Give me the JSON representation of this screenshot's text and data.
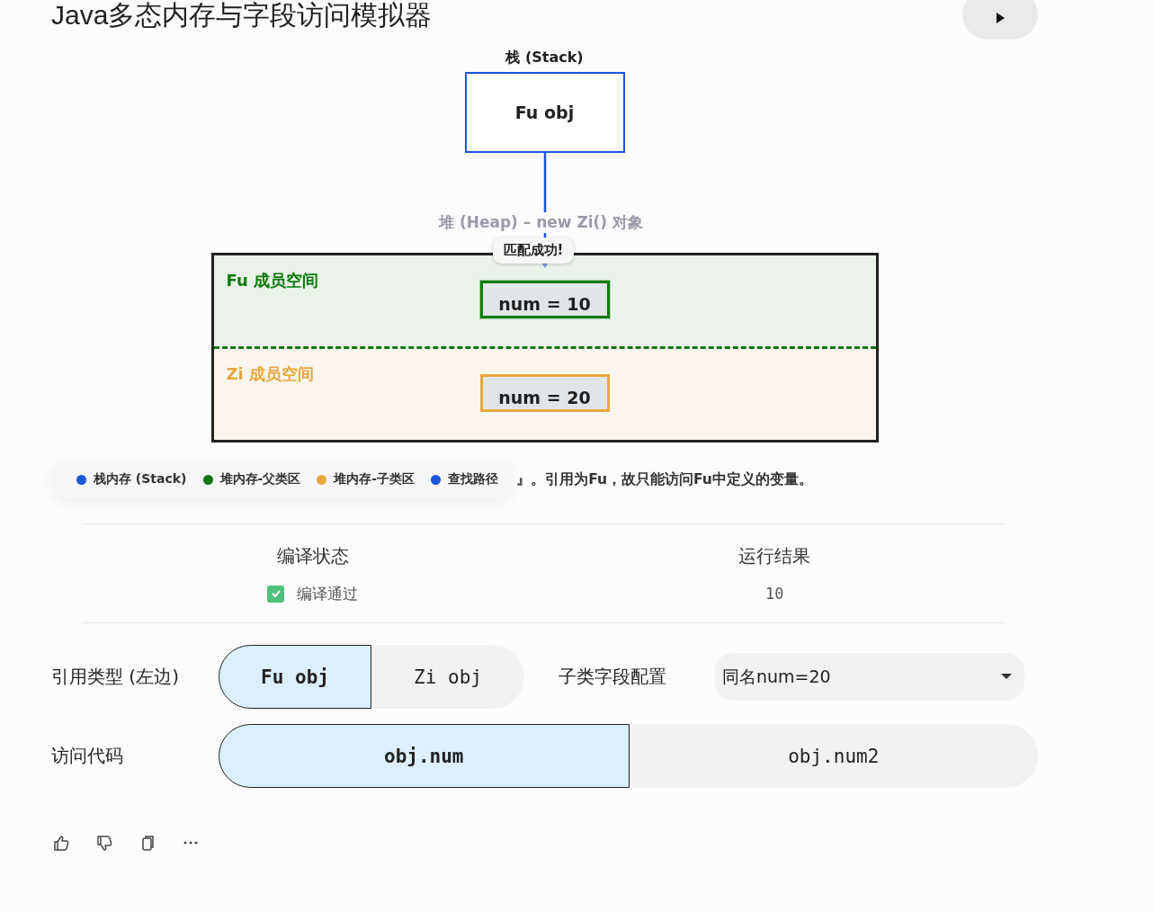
{
  "title": "Java多态内存与字段访问模拟器",
  "diagram": {
    "stack": {
      "label": "栈 (Stack)",
      "value": "Fu obj"
    },
    "heap": {
      "label": "堆 (Heap) – new Zi() 对象",
      "tooltip": "匹配成功!",
      "regions": [
        {
          "kind": "parent",
          "title": "Fu 成员空间",
          "field": "num = 10",
          "color": "#0a7a0a",
          "highlighted": true
        },
        {
          "kind": "child",
          "title": "Zi 成员空间",
          "field": "num = 20",
          "color": "#e8a83e",
          "highlighted": false
        }
      ]
    }
  },
  "legend": [
    {
      "label": "栈内存 (Stack)",
      "color": "#1a56db"
    },
    {
      "label": "堆内存-父类区",
      "color": "#0a7a0a"
    },
    {
      "label": "堆内存-子类区",
      "color": "#e8a83e"
    },
    {
      "label": "查找路径",
      "color": "#1a56db"
    }
  ],
  "explanation": "』。引用为Fu，故只能访问Fu中定义的变量。",
  "result": {
    "compile_header": "编译状态",
    "compile_ok": true,
    "compile_text": "编译通过",
    "run_header": "运行结果",
    "run_value": "10"
  },
  "controls": {
    "reference_label": "引用类型 (左边)",
    "reference_options": [
      {
        "label": "Fu obj",
        "selected": true
      },
      {
        "label": "Zi obj",
        "selected": false
      }
    ],
    "config_label": "子类字段配置",
    "config_value": "同名num=20",
    "access_label": "访问代码",
    "access_options": [
      {
        "label": "obj.num",
        "selected": true
      },
      {
        "label": "obj.num2",
        "selected": false
      }
    ]
  }
}
